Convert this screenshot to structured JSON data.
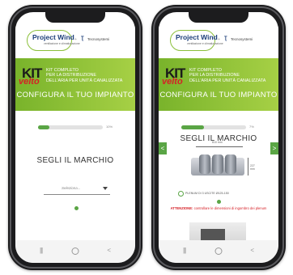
{
  "brand": {
    "logo_name": "Project Wind",
    "logo_sub": "ventilazione e climatizzazione",
    "partner": "Tecnosystemi"
  },
  "banner": {
    "kit": "KIT",
    "velto": "velto",
    "desc_lines": [
      "KIT COMPLETO",
      "PER LA DISTRIBUZIONE",
      "DELL'ARIA PER UNITÀ CANALIZZATA"
    ],
    "cta": "CONFIGURA IL TUO IMPIANTO"
  },
  "screen1": {
    "progress": 0.18,
    "progress_label": "10%",
    "title": "SEGLI IL MARCHIO",
    "select_placeholder": "Seleziona..."
  },
  "screen2": {
    "progress": 0.35,
    "progress_label": "7%",
    "title": "SEGLI IL MARCHIO",
    "dim_width": "810 mm",
    "dim_height": "227 mm",
    "option_label": "PLENUM DI 3 USCITE Ø125-150",
    "warning_bold": "ATTENZIONE:",
    "warning_text": "controllare le dimensioni di ingombro dei plenum"
  },
  "nav": {
    "recents": "|||",
    "home": "○",
    "back": "<",
    "prev_arrow": "<",
    "next_arrow": ">"
  },
  "colors": {
    "green": "#5aa545",
    "banner_green": "#8bc13a",
    "red": "#d62027",
    "navy": "#1d3f7a"
  }
}
